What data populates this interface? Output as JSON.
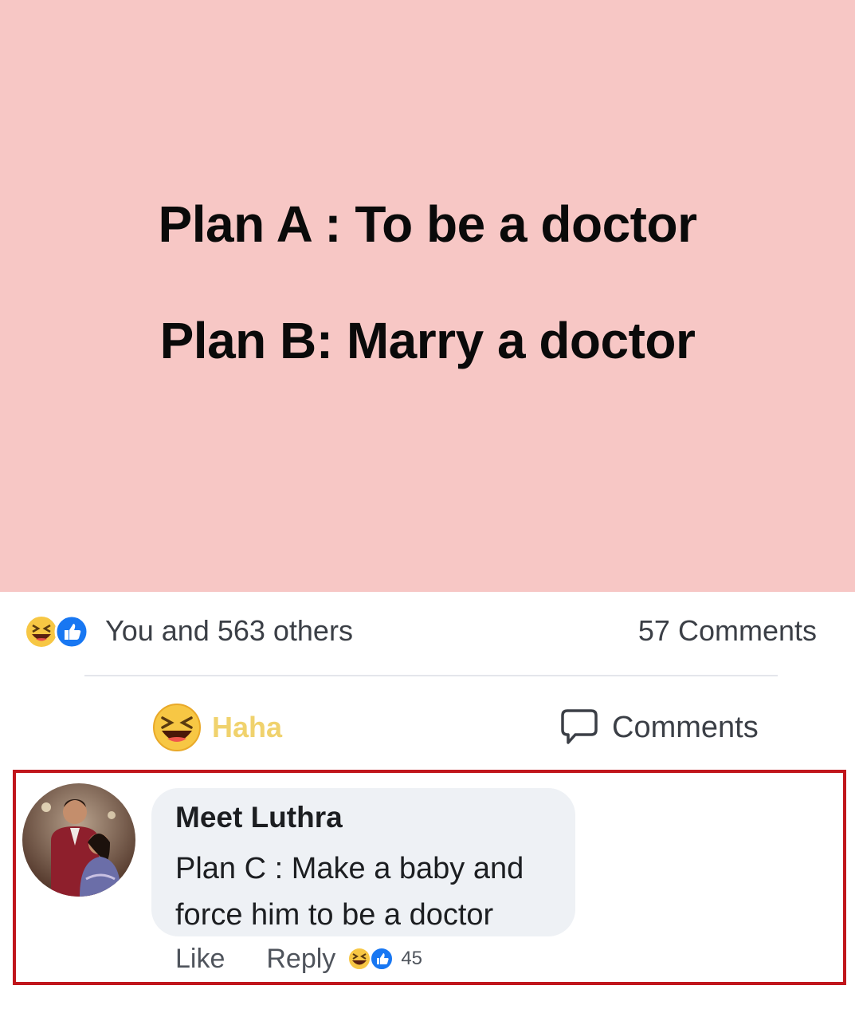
{
  "post": {
    "plan_a": "Plan A : To be a doctor",
    "plan_b": "Plan B: Marry a doctor",
    "background_color": "#f7c7c5"
  },
  "stats": {
    "reactions": [
      "haha-icon",
      "like-icon"
    ],
    "likers": "You and 563 others",
    "comment_count": "57 Comments"
  },
  "actions": {
    "haha_label": "Haha",
    "comments_label": "Comments"
  },
  "comment": {
    "author": "Meet Luthra",
    "text": "Plan C : Make a baby and force him to be a doctor",
    "like_label": "Like",
    "reply_label": "Reply",
    "reaction_count": "45",
    "highlight_color": "#c0161c"
  }
}
